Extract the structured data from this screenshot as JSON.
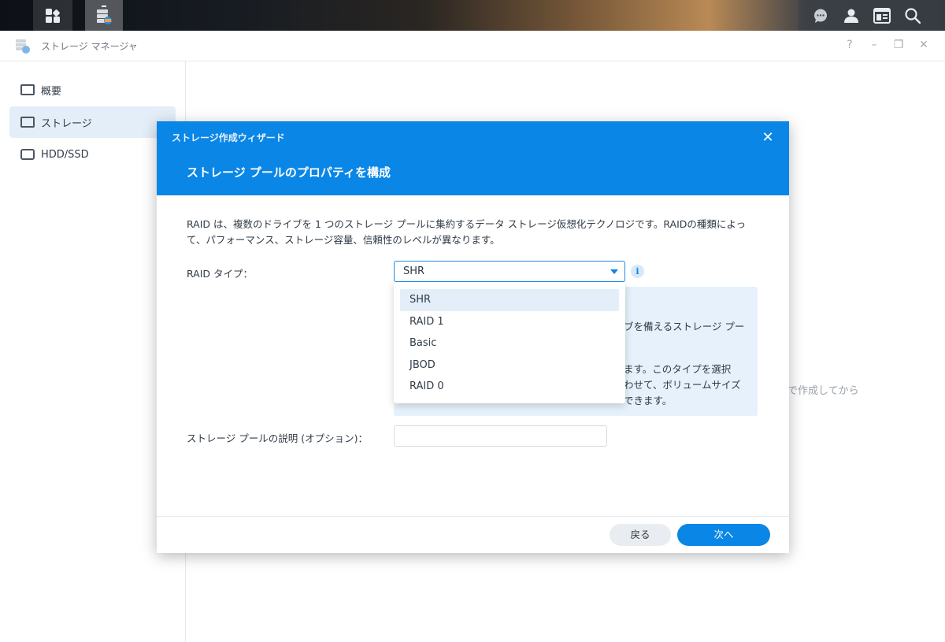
{
  "taskbar": {
    "icons": [
      "apps-grid-icon",
      "storage-manager-icon",
      "chat-icon",
      "user-icon",
      "widget-icon",
      "search-icon"
    ]
  },
  "window": {
    "title": "ストレージ マネージャ",
    "controls": {
      "help": "?",
      "minimize": "–",
      "restore": "❐",
      "close": "✕"
    }
  },
  "sidebar": {
    "items": [
      {
        "label": "概要",
        "icon": "overview-icon",
        "active": false
      },
      {
        "label": "ストレージ",
        "icon": "storage-icon",
        "active": true
      },
      {
        "label": "HDD/SSD",
        "icon": "disk-icon",
        "active": false
      }
    ]
  },
  "background_hint": "で作成してから",
  "dialog": {
    "wizard_label": "ストレージ作成ウィザード",
    "close": "✕",
    "title": "ストレージ プールのプロパティを構成",
    "description": "RAID は、複数のドライブを 1 つのストレージ プールに集約するデータ ストレージ仮想化テクノロジです。RAIDの種類によって、パフォーマンス、ストレージ容量、信頼性のレベルが異なります。",
    "raid_label": "RAID タイプ：",
    "raid_selected": "SHR",
    "raid_options": [
      "SHR",
      "RAID 1",
      "Basic",
      "JBOD",
      "RAID 0"
    ],
    "info_fragments": [
      "ブを備えるストレージ プー",
      "ます。このタイプを選択",
      "わせて、ボリュームサイズ",
      "できます。"
    ],
    "desc_label": "ストレージ プールの説明 (オプション)：",
    "desc_value": "",
    "back_label": "戻る",
    "next_label": "次へ"
  }
}
